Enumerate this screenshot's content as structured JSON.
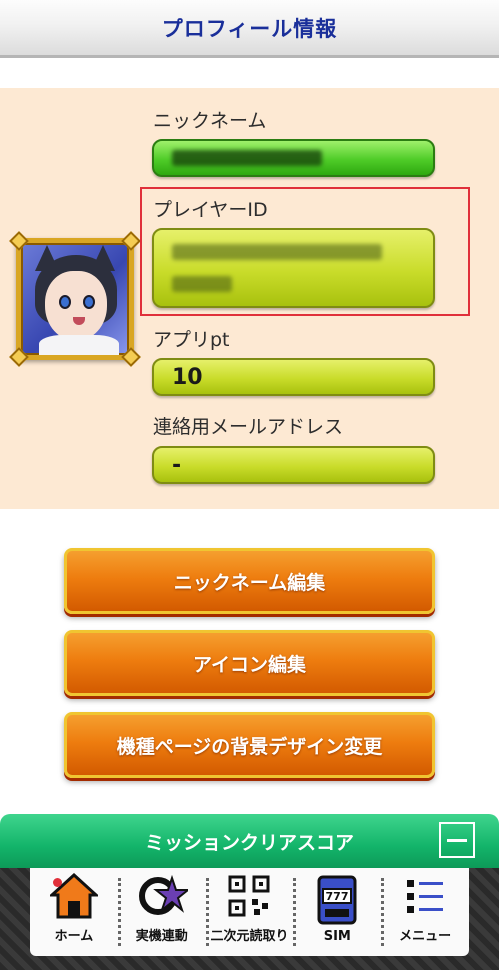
{
  "header": {
    "title": "プロフィール情報"
  },
  "profile": {
    "nickname_label": "ニックネーム",
    "player_id_label": "プレイヤーID",
    "app_pt_label": "アプリpt",
    "app_pt_value": "10",
    "email_label": "連絡用メールアドレス",
    "email_value": "-"
  },
  "buttons": {
    "edit_nickname": "ニックネーム編集",
    "edit_icon": "アイコン編集",
    "change_background": "機種ページの背景デザイン変更"
  },
  "mission": {
    "title": "ミッションクリアスコア"
  },
  "tabbar": {
    "home": "ホーム",
    "link": "実機連動",
    "qr": "二次元読取り",
    "sim": "SIM",
    "menu": "メニュー"
  },
  "colors": {
    "header_title": "#1a2f9a",
    "profile_bg": "#fde9d3",
    "pill_yellow": "#c9dc2a",
    "pill_green": "#4fcc28",
    "button_orange": "#ee7d0f",
    "mission_green": "#13b46a",
    "highlight_red": "#e0303a"
  }
}
